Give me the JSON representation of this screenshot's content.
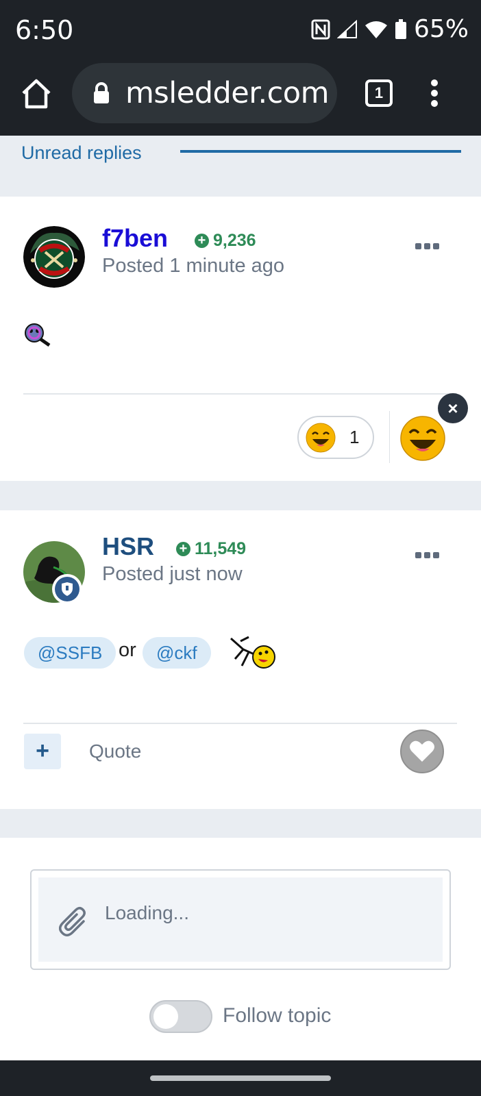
{
  "status_bar": {
    "time": "6:50",
    "battery": "65%"
  },
  "browser": {
    "url": "msledder.com",
    "tab_count": "1"
  },
  "unread": {
    "label": "Unread replies"
  },
  "posts": [
    {
      "author": "f7ben",
      "author_color": "#1a0dd6",
      "reputation": "9,236",
      "posted": "Posted 1 minute ago",
      "reaction_count": "1"
    },
    {
      "author": "HSR",
      "author_color": "#1e4e7e",
      "reputation": "11,549",
      "posted": "Posted just now",
      "mentions": [
        "@SSFB",
        "@ckf"
      ],
      "connector": "or",
      "quote_label": "Quote"
    }
  ],
  "editor": {
    "placeholder": "Loading...",
    "follow_label": "Follow topic"
  },
  "icons": [
    "home-icon",
    "lock-icon",
    "tabs-icon",
    "menu-icon",
    "more-icon",
    "laugh-reaction-icon",
    "close-icon",
    "plus-icon",
    "heart-icon",
    "paperclip-icon"
  ]
}
